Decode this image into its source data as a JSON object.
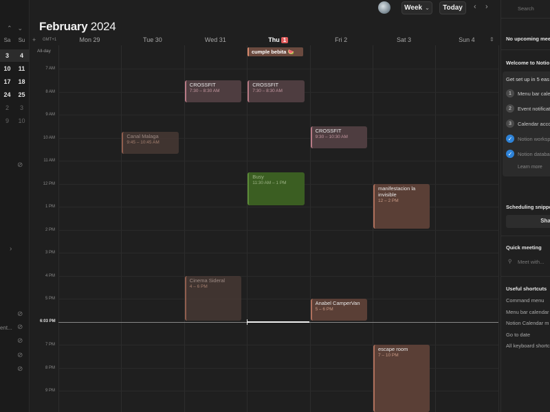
{
  "header": {
    "month": "February",
    "year": "2024",
    "view_label": "Week",
    "today_label": "Today",
    "prev_label": "‹",
    "next_label": "›",
    "view_caret": "⌄"
  },
  "grid_header": {
    "plus_label": "+",
    "timezone": "GMT+1",
    "allday_label": "All-day",
    "days": [
      {
        "label": "Mon 29",
        "today": false
      },
      {
        "label": "Tue 30",
        "today": false
      },
      {
        "label": "Wed 31",
        "today": false
      },
      {
        "label": "Thu",
        "today": true,
        "badge": "1"
      },
      {
        "label": "Fri 2",
        "today": false
      },
      {
        "label": "Sat 3",
        "today": false
      },
      {
        "label": "Sun 4",
        "today": false
      }
    ],
    "settings_glyph": "⇕"
  },
  "hours": [
    "7 AM",
    "8 AM",
    "9 AM",
    "10 AM",
    "11 AM",
    "12 PM",
    "1 PM",
    "2 PM",
    "3 PM",
    "4 PM",
    "5 PM",
    "",
    "7 PM",
    "8 PM",
    "9 PM"
  ],
  "now_label": "6:03 PM",
  "allday_event": {
    "title": "cumple bebita 🍉"
  },
  "events": [
    {
      "day": 2,
      "title": "CROSSFIT",
      "time": "7:30 – 8:30 AM",
      "style": "mauve past"
    },
    {
      "day": 3,
      "title": "CROSSFIT",
      "time": "7:30 – 8:30 AM",
      "style": "mauve past"
    },
    {
      "day": 1,
      "title": "Canal Malaga",
      "time": "9:45 – 10:45 AM",
      "style": "brown past"
    },
    {
      "day": 4,
      "title": "CROSSFIT",
      "time": "9:30 – 10:30 AM",
      "style": "mauve"
    },
    {
      "day": 3,
      "title": "Busy",
      "time": "11:30 AM – 1 PM",
      "style": "green"
    },
    {
      "day": 5,
      "title": "manifestacion la invisible",
      "time": "12 – 2 PM",
      "style": "brown"
    },
    {
      "day": 2,
      "title": "Cinema Sideral",
      "time": "4 – 6 PM",
      "style": "brown past"
    },
    {
      "day": 4,
      "title": "Anabel CamperVan",
      "time": "5 – 6 PM",
      "style": "brown"
    },
    {
      "day": 5,
      "title": "escape room",
      "time": "7 – 10 PM",
      "style": "brown"
    }
  ],
  "mini_calendar": {
    "nav_up": "⌃",
    "nav_down": "⌄",
    "dow": [
      "Sa",
      "Su"
    ],
    "rows": [
      {
        "days": [
          "3",
          "4"
        ],
        "current": true,
        "dim": false
      },
      {
        "days": [
          "10",
          "11"
        ],
        "current": false,
        "dim": false
      },
      {
        "days": [
          "17",
          "18"
        ],
        "current": false,
        "dim": false
      },
      {
        "days": [
          "24",
          "25"
        ],
        "current": false,
        "dim": false
      },
      {
        "days": [
          "2",
          "3"
        ],
        "current": false,
        "dim": true
      },
      {
        "days": [
          "9",
          "10"
        ],
        "current": false,
        "dim": true
      }
    ],
    "side_label": "ent..."
  },
  "right_panel": {
    "search_placeholder": "Search",
    "no_upcoming": "No upcoming meet",
    "welcome": "Welcome to Notio",
    "setup_title": "Get set up in 5 eas",
    "steps": [
      {
        "num": "1",
        "label": "Menu bar cale"
      },
      {
        "num": "2",
        "label": "Event notificat"
      },
      {
        "num": "3",
        "label": "Calendar acco"
      }
    ],
    "checked_steps": [
      "Notion worksp",
      "Notion databa"
    ],
    "learn_more": "Learn more",
    "scheduling_title": "Scheduling snippet",
    "share_label": "Shar",
    "quick_meeting_title": "Quick meeting",
    "meet_with_placeholder": "Meet with...",
    "shortcuts_title": "Useful shortcuts",
    "shortcuts": [
      "Command menu",
      "Menu bar calendar",
      "Notion Calendar m",
      "Go to date",
      "All keyboard shortc"
    ]
  }
}
